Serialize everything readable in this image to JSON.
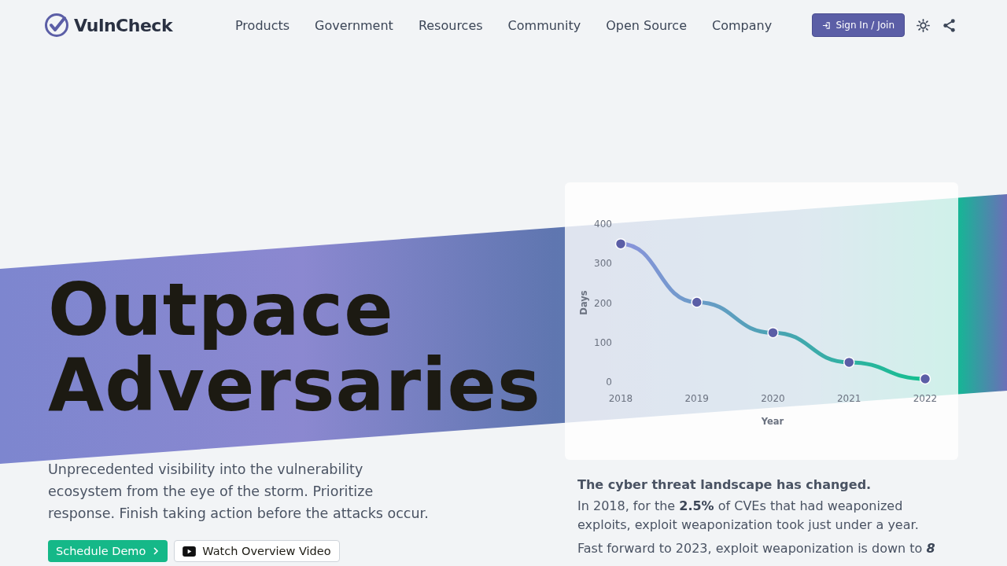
{
  "header": {
    "logo": "VulnCheck",
    "nav": [
      "Products",
      "Government",
      "Resources",
      "Community",
      "Open Source",
      "Company"
    ],
    "sign_in": "Sign In / Join"
  },
  "hero": {
    "title_lines": [
      "Outpace",
      "Adversaries"
    ],
    "subtitle": "Unprecedented visibility into the vulnerability ecosystem from the eye of the storm. Prioritize response. Finish taking action before the attacks occur.",
    "buttons": [
      {
        "kind": "primary",
        "label": "Schedule Demo"
      },
      {
        "kind": "video",
        "label": "Watch Overview Video"
      }
    ]
  },
  "chart_data": {
    "type": "line",
    "xlabel": "Year",
    "ylabel": "Days",
    "categories": [
      "2018",
      "2019",
      "2020",
      "2021",
      "2022"
    ],
    "series": [
      {
        "color": "#5b5ea6",
        "marker": "circle",
        "values": [
          350,
          202,
          125,
          50,
          8
        ]
      }
    ],
    "ylim": [
      0,
      400
    ],
    "yticks": [
      0,
      100,
      200,
      300,
      400
    ]
  },
  "info": {
    "heading": "The cyber threat landscape has changed.",
    "paragraphs": [
      "In 2018, for the **2.5%** of CVEs that had weaponized exploits, exploit weaponization took just under a year.",
      "Fast forward to 2023, exploit weaponization is down to **8**"
    ]
  }
}
